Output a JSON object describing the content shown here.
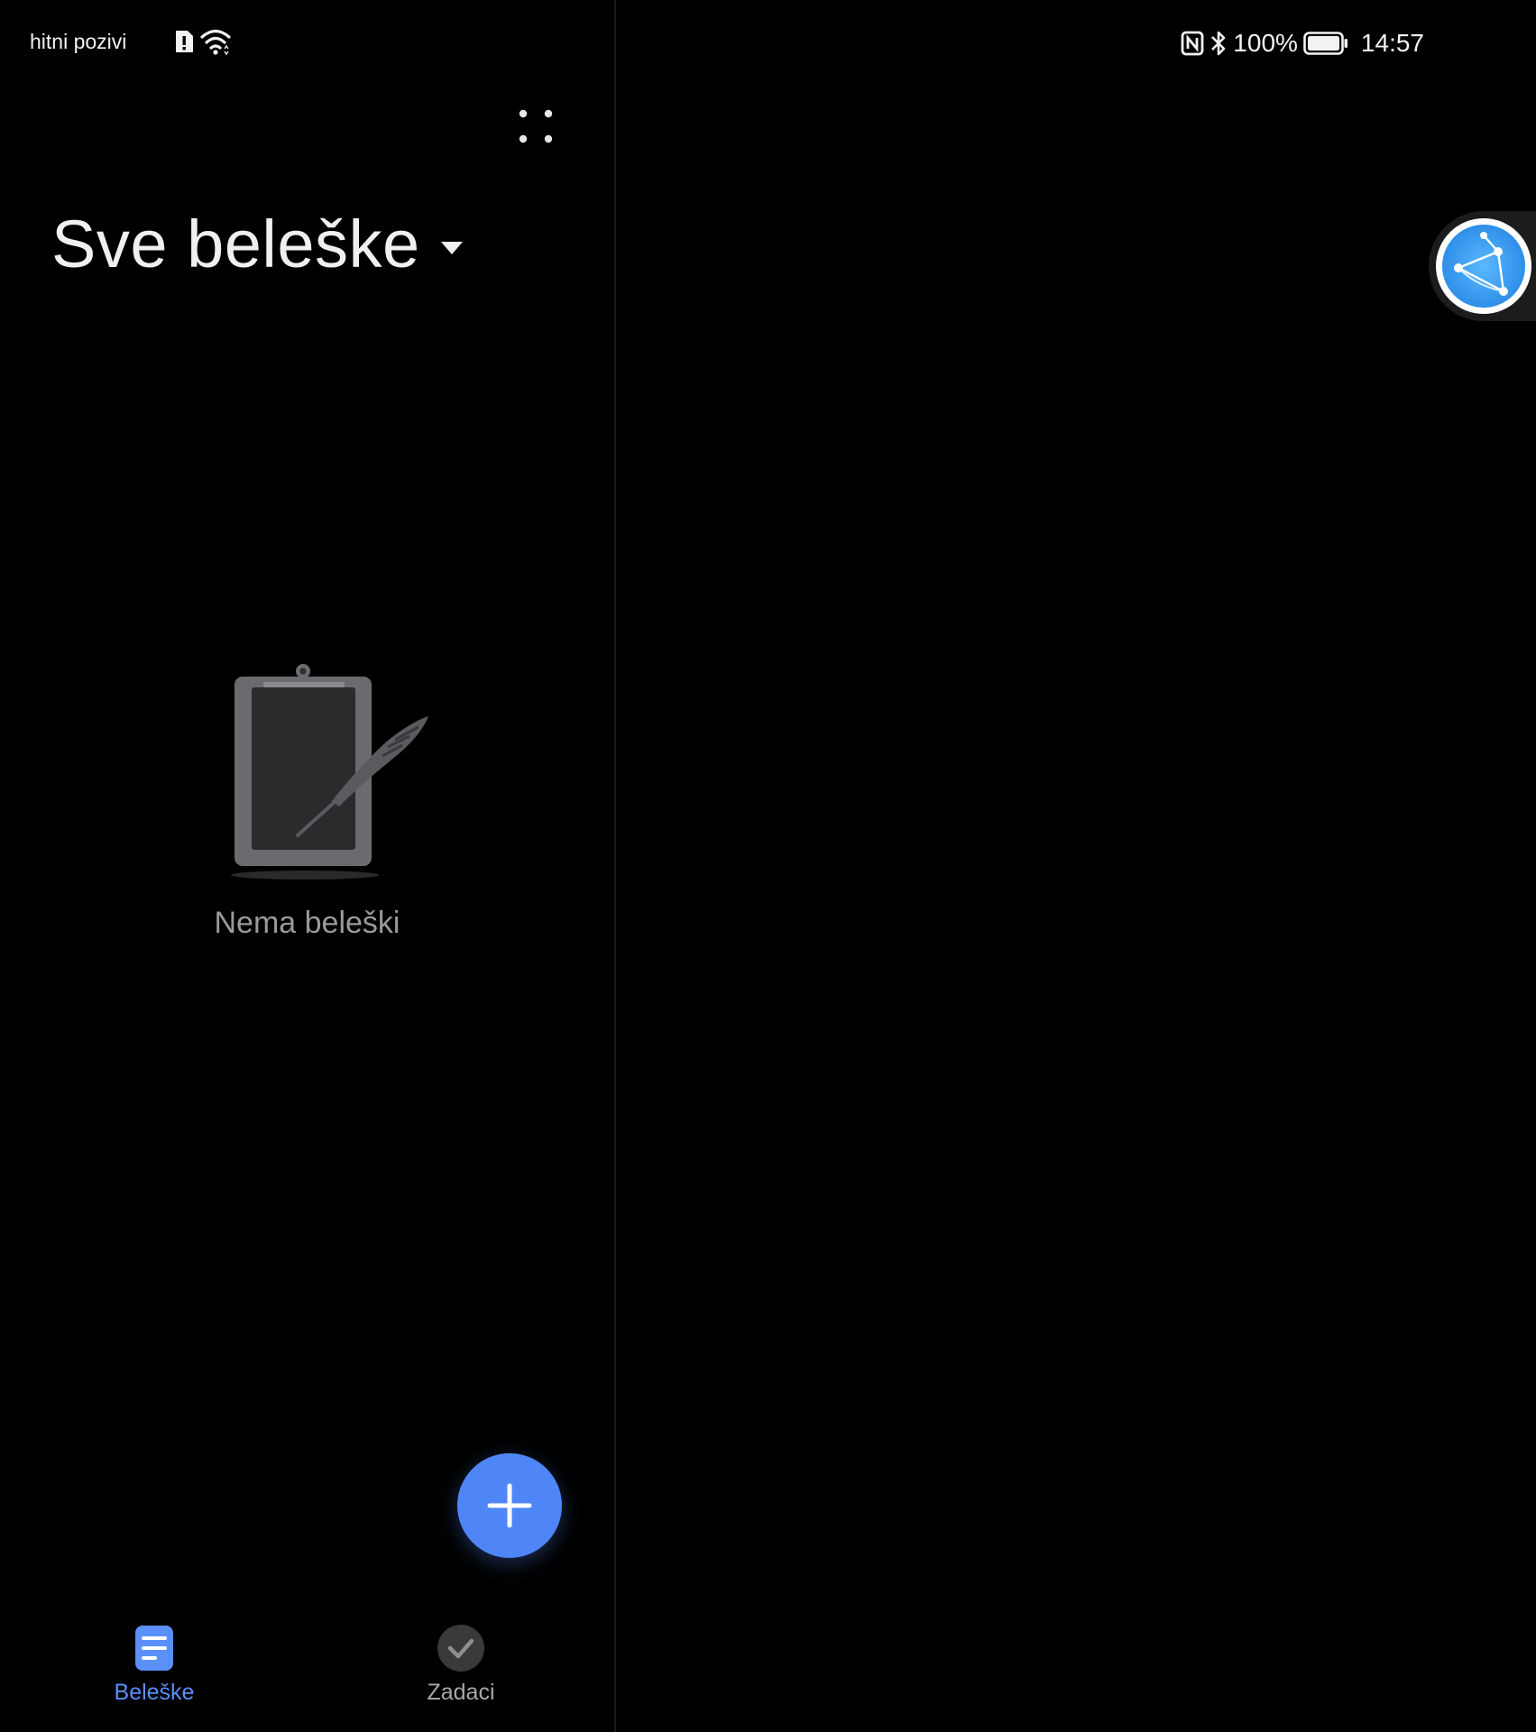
{
  "status_bar": {
    "carrier": "hitni pozivi",
    "battery": "100%",
    "time": "14:57"
  },
  "header": {
    "title": "Sve beleške"
  },
  "empty_state": {
    "message": "Nema beleški"
  },
  "bottom_nav": {
    "tabs": [
      {
        "label": "Beleške",
        "icon": "notes-icon",
        "active": true
      },
      {
        "label": "Zadaci",
        "icon": "checkmark-icon",
        "active": false
      }
    ]
  },
  "colors": {
    "accent": "#4f86f7",
    "background": "#000000",
    "inactive": "#a8a8a8"
  }
}
